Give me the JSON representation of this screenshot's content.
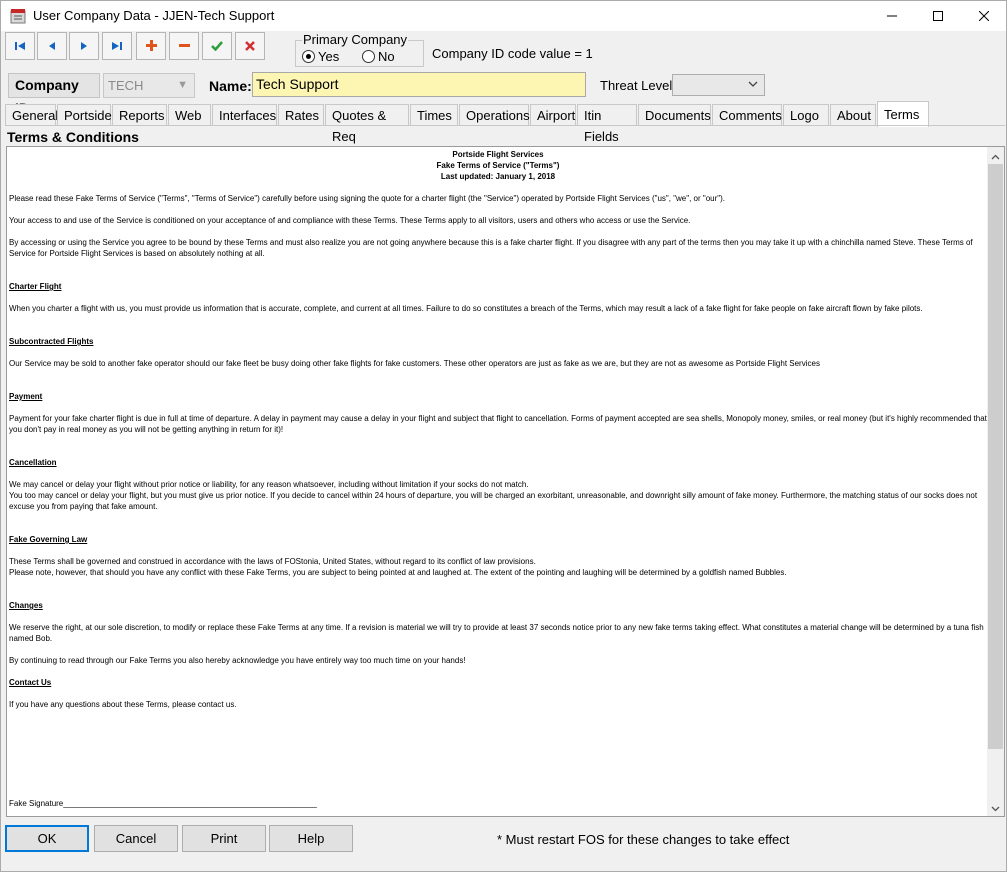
{
  "window": {
    "title": "User Company Data - JJEN-Tech Support",
    "app_icon": "app-calendar-icon",
    "controls": [
      "minimize-icon",
      "maximize-icon",
      "close-icon"
    ]
  },
  "toolbar": {
    "buttons": [
      {
        "name": "first-record",
        "icon": "skip-first-icon",
        "color": "#1565c0"
      },
      {
        "name": "previous-record",
        "icon": "triangle-left-icon",
        "color": "#1565c0"
      },
      {
        "name": "next-record",
        "icon": "triangle-right-icon",
        "color": "#1565c0"
      },
      {
        "name": "last-record",
        "icon": "skip-last-icon",
        "color": "#1565c0"
      },
      {
        "name": "add-record",
        "icon": "plus-icon",
        "color": "#e0531b"
      },
      {
        "name": "delete-record",
        "icon": "minus-icon",
        "color": "#e0531b"
      },
      {
        "name": "save-record",
        "icon": "check-icon",
        "color": "#2e9e3a"
      },
      {
        "name": "cancel-record",
        "icon": "x-icon",
        "color": "#d32f2f"
      }
    ]
  },
  "primary_company": {
    "legend": "Primary Company",
    "yes_label": "Yes",
    "no_label": "No",
    "selected": "Yes"
  },
  "company_code": "Company ID code value = 1",
  "company_id": {
    "label": "Company ID:",
    "value": "TECH"
  },
  "name": {
    "label": "Name:",
    "value": "Tech Support",
    "bg_color": "#fdf5b2"
  },
  "threat_level": {
    "label": "Threat Level:",
    "value": ""
  },
  "tabs": [
    {
      "label": "General"
    },
    {
      "label": "Portside"
    },
    {
      "label": "Reports"
    },
    {
      "label": "Web"
    },
    {
      "label": "Interfaces"
    },
    {
      "label": "Rates"
    },
    {
      "label": "Quotes & Req"
    },
    {
      "label": "Times"
    },
    {
      "label": "Operations"
    },
    {
      "label": "Airport"
    },
    {
      "label": "Itin Fields"
    },
    {
      "label": "Documents"
    },
    {
      "label": "Comments"
    },
    {
      "label": "Logo"
    },
    {
      "label": "About"
    },
    {
      "label": "Terms"
    }
  ],
  "active_tab": "Terms",
  "section_title": "Terms & Conditions",
  "terms": {
    "header1": "Portside Flight Services",
    "header2": "Fake Terms of Service (\"Terms\")",
    "header3": "Last updated: January 1, 2018",
    "p1": "Please read these Fake Terms of Service (\"Terms\", \"Terms of Service\") carefully before using signing the quote for a charter flight (the \"Service\") operated by Portside Flight Services (\"us\", \"we\", or \"our\").",
    "p2": "Your access to and use of the Service is conditioned on your acceptance of and compliance with these Terms. These Terms apply to all visitors, users and others who access or use the Service.",
    "p3": "By accessing or using the Service you agree to be bound by these Terms and must also realize you are not going anywhere because this is a fake charter flight. If you disagree with any part of the terms then you may take it up with a chinchilla named Steve. These Terms of Service for Portside Flight Services is based on absolutely nothing at all.",
    "h_charter": "Charter Flight",
    "p_charter": "When you charter a flight with us, you must provide us information that is accurate, complete, and current at all times. Failure to do so constitutes a breach of the Terms, which may result a lack of a fake flight for fake people on fake aircraft flown by fake pilots.",
    "h_sub": "Subcontracted Flights",
    "p_sub": "Our Service may be sold to another fake operator should our fake fleet be busy doing other fake flights for fake customers. These other operators are just as fake as we are, but they are not as awesome as Portside Flight Services",
    "h_payment": "Payment",
    "p_payment": "Payment for your fake charter flight is due in full at time of departure. A delay in payment may cause a delay in your flight and subject that flight to cancellation. Forms of payment accepted are sea shells, Monopoly money, smiles, or real money (but it's highly recommended that you don't pay in real money as you will not be getting anything in return for it)!",
    "h_cancel": "Cancellation",
    "p_cancel1": "We may cancel or delay your flight without prior notice or liability, for any reason whatsoever, including without limitation if your socks do not match.",
    "p_cancel2": "You too may cancel or delay your flight, but you must give us prior notice. If you decide to cancel within 24 hours of departure, you will be charged an exorbitant, unreasonable, and downright silly amount of fake money. Furthermore, the matching status of our socks does not excuse you from paying that fake amount.",
    "h_law": "Fake Governing Law",
    "p_law1": "These Terms shall be governed and construed in accordance with the laws of FOStonia, United States, without regard to its conflict of law provisions.",
    "p_law2": "Please note, however, that should you have any conflict with these Fake Terms, you are subject to being pointed at and laughed at. The extent of the pointing and laughing will be determined by a goldfish named Bubbles.",
    "h_changes": "Changes",
    "p_changes": "We reserve the right, at our sole discretion, to modify or replace these Fake Terms at any time. If a revision is material we will try to provide at least 37 seconds notice prior to any new fake terms taking effect. What constitutes a material change will be determined by a tuna fish named Bob.",
    "p_continue": "By continuing to read through our Fake Terms you also hereby acknowledge you have entirely way too much time on your hands!",
    "h_contact": "Contact Us",
    "p_contact": "If you have any questions about these Terms, please contact us.",
    "signature": "Fake Signature_________________________________________________________"
  },
  "buttons": {
    "ok": "OK",
    "cancel": "Cancel",
    "print": "Print",
    "help": "Help"
  },
  "restart_note": "* Must restart FOS for these changes to take effect"
}
